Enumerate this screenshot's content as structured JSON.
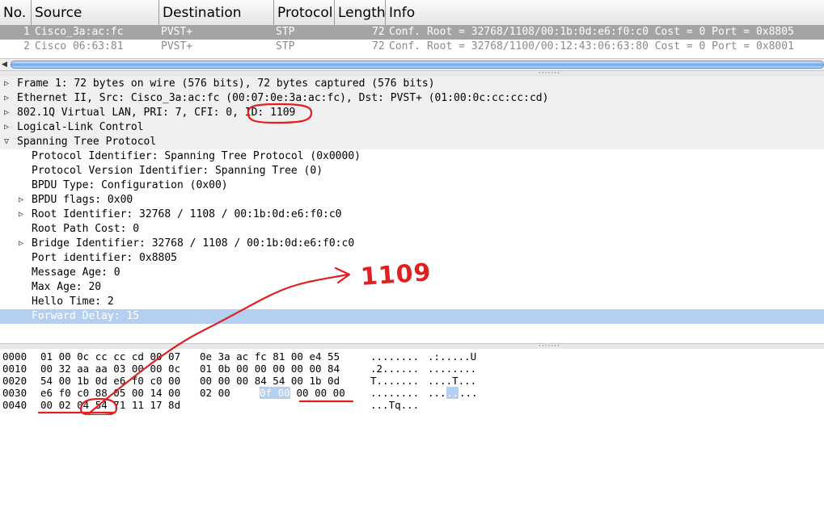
{
  "packet_list": {
    "columns": [
      "No.",
      "Source",
      "Destination",
      "Protocol",
      "Length",
      "Info"
    ],
    "rows": [
      {
        "no": "1",
        "source": "Cisco_3a:ac:fc",
        "destination": "PVST+",
        "protocol": "STP",
        "length": "72",
        "info": "Conf. Root = 32768/1108/00:1b:0d:e6:f0:c0  Cost = 0  Port = 0x8805"
      },
      {
        "no": "2",
        "source": "Cisco_06:63:81",
        "destination": "PVST+",
        "protocol": "STP",
        "length": "72",
        "info": "Conf. Root = 32768/1100/00:12:43:06:63:80  Cost = 0  Port = 0x8001"
      }
    ],
    "selected_row": 1
  },
  "details": [
    {
      "text": "Frame 1: 72 bytes on wire (576 bits), 72 bytes captured (576 bits)",
      "expander": "collapsed",
      "level": 0
    },
    {
      "text": "Ethernet II, Src: Cisco_3a:ac:fc (00:07:0e:3a:ac:fc), Dst: PVST+ (01:00:0c:cc:cc:cd)",
      "expander": "collapsed",
      "level": 0
    },
    {
      "text": "802.1Q Virtual LAN, PRI: 7, CFI: 0, ID: 1109",
      "expander": "collapsed",
      "level": 0
    },
    {
      "text": "Logical-Link Control",
      "expander": "collapsed",
      "level": 0
    },
    {
      "text": "Spanning Tree Protocol",
      "expander": "expanded",
      "level": 0
    },
    {
      "text": "Protocol Identifier: Spanning Tree Protocol (0x0000)",
      "expander": "none",
      "level": 1
    },
    {
      "text": "Protocol Version Identifier: Spanning Tree (0)",
      "expander": "none",
      "level": 1
    },
    {
      "text": "BPDU Type: Configuration (0x00)",
      "expander": "none",
      "level": 1
    },
    {
      "text": "BPDU flags: 0x00",
      "expander": "collapsed",
      "level": 1
    },
    {
      "text": "Root Identifier: 32768 / 1108 / 00:1b:0d:e6:f0:c0",
      "expander": "collapsed",
      "level": 1
    },
    {
      "text": "Root Path Cost: 0",
      "expander": "none",
      "level": 1
    },
    {
      "text": "Bridge Identifier: 32768 / 1108 / 00:1b:0d:e6:f0:c0",
      "expander": "collapsed",
      "level": 1
    },
    {
      "text": "Port identifier: 0x8805",
      "expander": "none",
      "level": 1
    },
    {
      "text": "Message Age: 0",
      "expander": "none",
      "level": 1
    },
    {
      "text": "Max Age: 20",
      "expander": "none",
      "level": 1
    },
    {
      "text": "Hello Time: 2",
      "expander": "none",
      "level": 1
    },
    {
      "text": "Forward Delay: 15",
      "expander": "none",
      "level": 1,
      "selected": true
    }
  ],
  "hex_dump": [
    {
      "offset": "0000",
      "bytes1": "01 00 0c cc cc cd 00 07",
      "bytes2": "0e 3a ac fc 81 00 e4 55",
      "ascii1": "........",
      "ascii2": ".:.....U"
    },
    {
      "offset": "0010",
      "bytes1": "00 32 aa aa 03 00 00 0c",
      "bytes2": "01 0b 00 00 00 00 00 84",
      "ascii1": ".2......",
      "ascii2": "........"
    },
    {
      "offset": "0020",
      "bytes1": "54 00 1b 0d e6 f0 c0 00",
      "bytes2": "00 00 00 84 54 00 1b 0d",
      "ascii1": "T.......",
      "ascii2": "....T..."
    },
    {
      "offset": "0030",
      "bytes1": "e6 f0 c0 88 05 00 14 00",
      "bytes2": "02 00 0f 00 00 00 00",
      "ascii1": "........",
      "ascii2": "..."
    },
    {
      "offset": "0040",
      "bytes1": "00 02 04 54 71 11 17 8d",
      "bytes2": "",
      "ascii1": "...Tq...",
      "ascii2": ""
    }
  ],
  "hex_highlight": {
    "bytes": "0f 00",
    "ascii": ".."
  },
  "hex_row3_tail": {
    "bytes_before": "02 00 ",
    "bytes_after": " 00 00 00",
    "ascii_before": "...",
    "ascii_after": "..."
  },
  "annotation": {
    "text": "1109",
    "color": "#e02020"
  }
}
